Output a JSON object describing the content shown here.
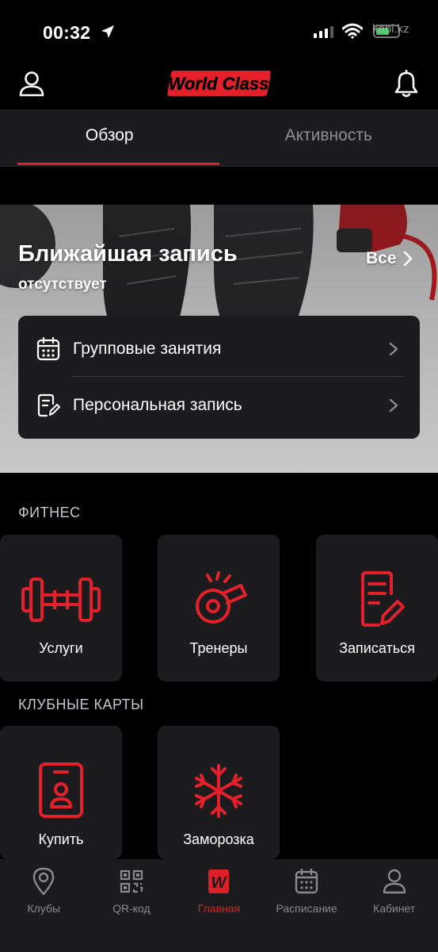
{
  "status_bar": {
    "time": "00:32",
    "watermark": "kapi.kz"
  },
  "header": {
    "logo_text": "World Class"
  },
  "tabs": [
    {
      "label": "Обзор",
      "active": true
    },
    {
      "label": "Активность",
      "active": false
    }
  ],
  "upcoming": {
    "title": "Ближайшая запись",
    "subtitle": "отсутствует",
    "all_label": "Все",
    "rows": [
      {
        "label": "Групповые занятия",
        "icon": "calendar-icon"
      },
      {
        "label": "Персональная запись",
        "icon": "document-edit-icon"
      }
    ]
  },
  "fitness": {
    "title": "ФИТНЕС",
    "tiles": [
      {
        "label": "Услуги",
        "icon": "dumbbell-icon"
      },
      {
        "label": "Тренеры",
        "icon": "whistle-icon"
      },
      {
        "label": "Записаться",
        "icon": "document-edit-icon"
      }
    ]
  },
  "club_cards": {
    "title": "КЛУБНЫЕ КАРТЫ",
    "tiles": [
      {
        "label": "Купить",
        "icon": "badge-person-icon"
      },
      {
        "label": "Заморозка",
        "icon": "snowflake-icon"
      }
    ]
  },
  "bottom_nav": [
    {
      "label": "Клубы",
      "icon": "location-pin-icon",
      "active": false
    },
    {
      "label": "QR-код",
      "icon": "qr-code-icon",
      "active": false
    },
    {
      "label": "Главная",
      "icon": "world-class-w-icon",
      "active": true
    },
    {
      "label": "Расписание",
      "icon": "calendar-icon",
      "active": false
    },
    {
      "label": "Кабинет",
      "icon": "profile-icon",
      "active": false
    }
  ],
  "colors": {
    "accent": "#e4202a",
    "background": "#000000",
    "surface": "#1c1c1e",
    "inactive": "#8e8e93"
  }
}
